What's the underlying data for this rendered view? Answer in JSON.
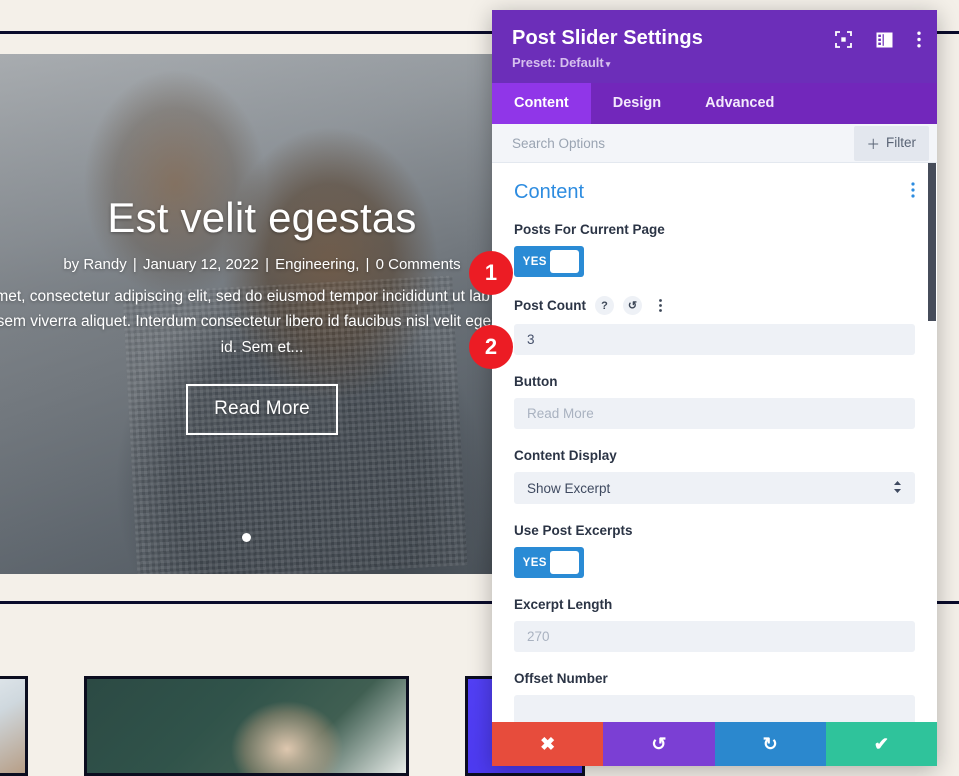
{
  "background_page": {
    "hero": {
      "title": "Est velit egestas",
      "meta": {
        "author": "by Randy",
        "date": "January 12, 2022",
        "category": "Engineering,",
        "comments": "0 Comments"
      },
      "excerpt": "it amet, consectetur adipiscing elit, sed do eiusmod tempor incididunt ut lab ed enim ut sem viverra aliquet. Interdum consectetur libero id faucibus nisl velit egestas dui id. Sem et...",
      "read_more_label": "Read More",
      "pagination_dots": 1
    }
  },
  "annotations": [
    {
      "number": "1"
    },
    {
      "number": "2"
    }
  ],
  "modal": {
    "title": "Post Slider Settings",
    "preset_label": "Preset: Default",
    "preset_caret": "▾",
    "header_icons": [
      {
        "name": "focus-icon"
      },
      {
        "name": "panel-layout-icon"
      },
      {
        "name": "kebab-menu-icon"
      }
    ],
    "tabs": [
      {
        "label": "Content",
        "active": true
      },
      {
        "label": "Design",
        "active": false
      },
      {
        "label": "Advanced",
        "active": false
      }
    ],
    "search": {
      "value": "",
      "placeholder": "Search Options"
    },
    "filter_button": {
      "label": "Filter",
      "icon": "plus-icon"
    },
    "section": {
      "title": "Content",
      "kebab": "⋮"
    },
    "fields": [
      {
        "id": "posts-for-current-page",
        "label": "Posts For Current Page",
        "type": "toggle",
        "value": "YES"
      },
      {
        "id": "post-count",
        "label": "Post Count",
        "type": "text",
        "value": "3",
        "placeholder": "",
        "icons": [
          "help-icon",
          "reset-icon",
          "kebab-menu-icon"
        ]
      },
      {
        "id": "button",
        "label": "Button",
        "type": "text",
        "value": "",
        "placeholder": "Read More"
      },
      {
        "id": "content-display",
        "label": "Content Display",
        "type": "select",
        "value": "Show Excerpt"
      },
      {
        "id": "use-post-excerpts",
        "label": "Use Post Excerpts",
        "type": "toggle",
        "value": "YES"
      },
      {
        "id": "excerpt-length",
        "label": "Excerpt Length",
        "type": "text",
        "value": "",
        "placeholder": "270"
      },
      {
        "id": "offset-number",
        "label": "Offset Number",
        "type": "text",
        "value": "",
        "placeholder": ""
      }
    ],
    "action_bar": [
      {
        "id": "cancel",
        "icon": "close-icon",
        "glyph": "✖",
        "color": "#e74c3c"
      },
      {
        "id": "undo",
        "icon": "undo-icon",
        "glyph": "↺",
        "color": "#7b3fd4"
      },
      {
        "id": "redo",
        "icon": "redo-icon",
        "glyph": "↻",
        "color": "#2b88ce"
      },
      {
        "id": "save",
        "icon": "check-icon",
        "glyph": "✔",
        "color": "#2fc39b"
      }
    ]
  },
  "colors": {
    "modal_header": "#6c2eb9",
    "tab_bar": "#7227bb",
    "tab_active": "#9036e8",
    "section_title": "#2d8ce0",
    "toggle_on": "#2a8bd5",
    "badge": "#ec1c24",
    "page_background": "#f4f0e9",
    "rule": "#090b2b"
  }
}
